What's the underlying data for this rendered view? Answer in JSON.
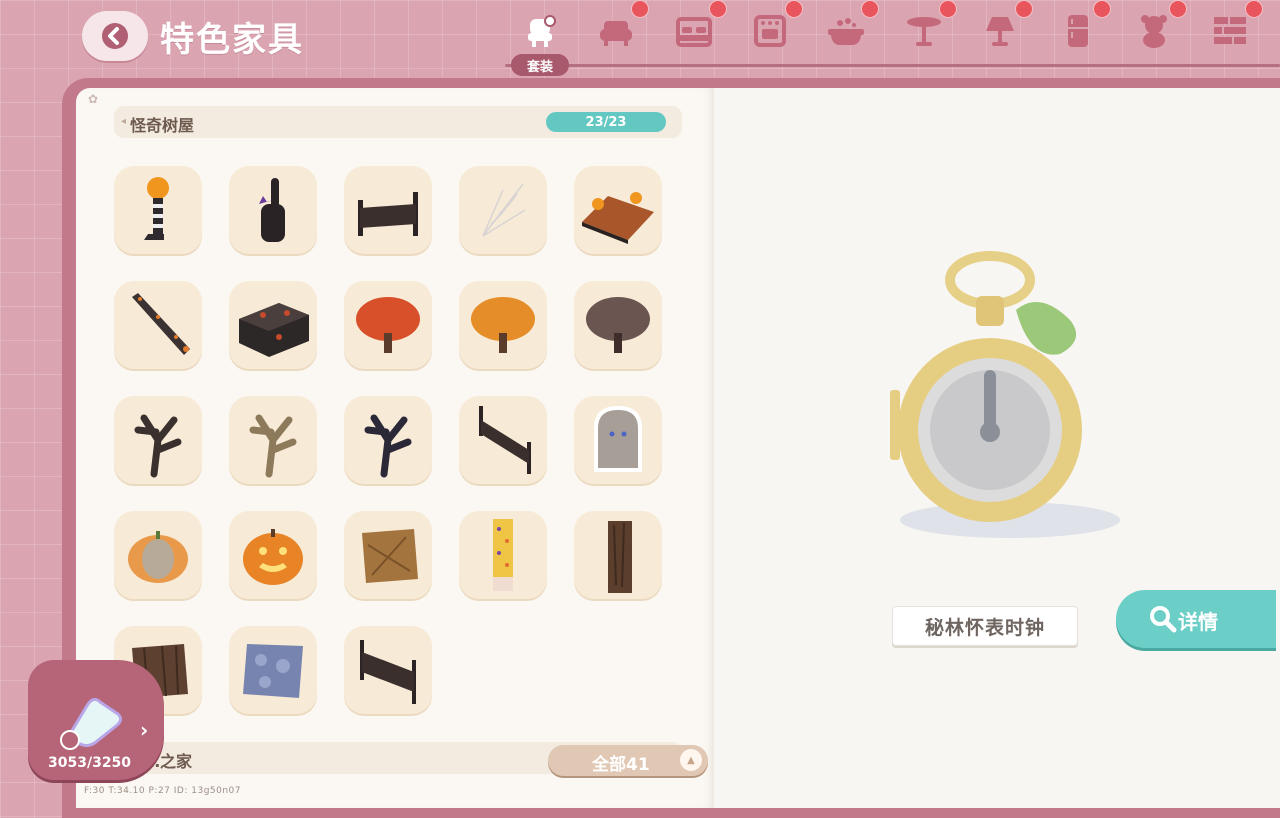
{
  "header": {
    "title": "特色家具"
  },
  "category_tabs": [
    {
      "id": "outfit",
      "icon": "outfit-set-icon",
      "label": "套装",
      "active": true,
      "badge": false
    },
    {
      "id": "sofa",
      "icon": "armchair-icon",
      "badge": true
    },
    {
      "id": "bed",
      "icon": "bed-icon",
      "badge": true
    },
    {
      "id": "cabinet",
      "icon": "oven-icon",
      "badge": true
    },
    {
      "id": "bath",
      "icon": "bathtub-icon",
      "badge": true
    },
    {
      "id": "table",
      "icon": "table-icon",
      "badge": true
    },
    {
      "id": "lamp",
      "icon": "lamp-icon",
      "badge": true
    },
    {
      "id": "fridge",
      "icon": "fridge-icon",
      "badge": true
    },
    {
      "id": "toy",
      "icon": "teddy-bear-icon",
      "badge": true
    },
    {
      "id": "wall",
      "icon": "brick-wall-icon",
      "badge": true
    }
  ],
  "set_section": {
    "title": "怪奇树屋",
    "count": "23/23"
  },
  "items": [
    "pumpkin-lamp",
    "cat-statue",
    "spooky-fence",
    "cobweb",
    "pumpkin-roof",
    "spooky-stairs",
    "spooky-steps",
    "orange-red-tree",
    "orange-tree",
    "brown-tree",
    "dead-tree-dark",
    "dead-tree-pale",
    "dead-tree-blue",
    "spooky-fence-angled",
    "ghost-picture",
    "pumpkin-pale",
    "jack-o-lantern",
    "wood-floor-tile",
    "candy-wallpaper",
    "bark-panel",
    "bark-floor",
    "stone-floor-tile",
    "spooky-fence-tall"
  ],
  "next_section": {
    "title": "…之家"
  },
  "filter": {
    "label": "全部41"
  },
  "debug": "F:30    T:34.10    P:27    ID: 13g50n07",
  "puzzle": {
    "count": "3053/3250"
  },
  "preview": {
    "name": "秘林怀表时钟",
    "detail_label": "详情"
  },
  "colors": {
    "accent": "#63c8c1",
    "badge": "#e9555d",
    "tab_active": "#a8596b",
    "cover": "#c27a8a"
  }
}
